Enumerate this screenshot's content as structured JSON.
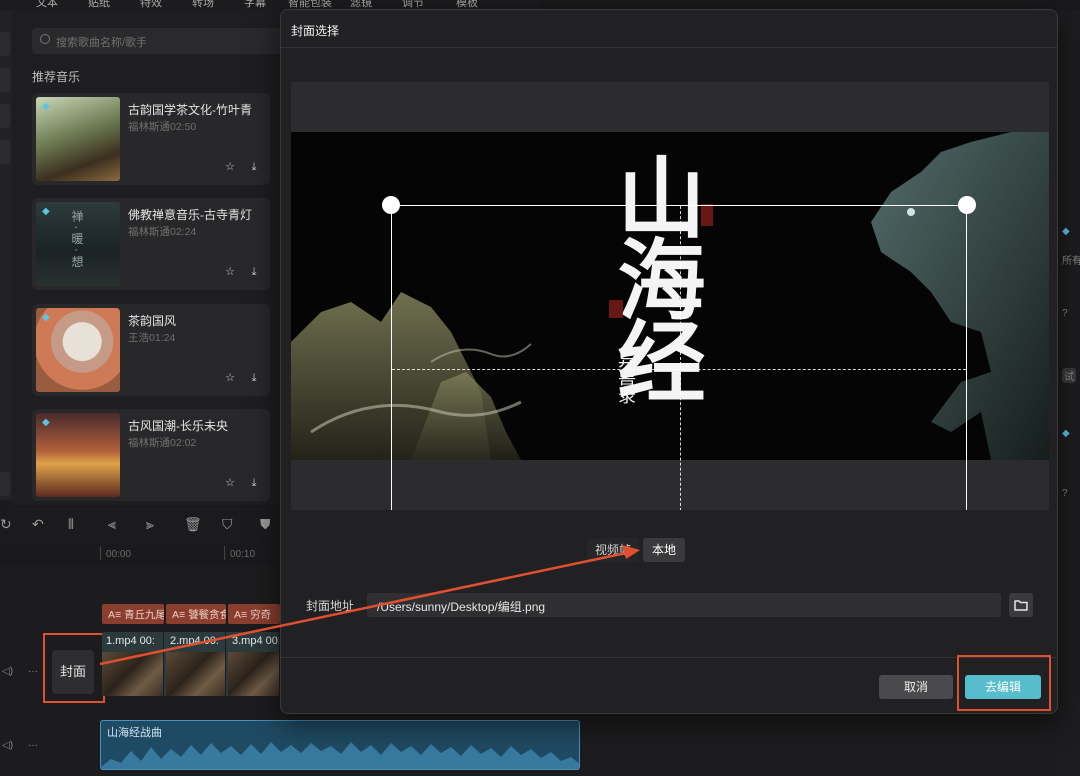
{
  "top_tabs": [
    "文本",
    "贴纸",
    "特效",
    "转场",
    "字幕",
    "智能包装",
    "滤镜",
    "调节",
    "模板"
  ],
  "music_panel": {
    "search_placeholder": "搜索歌曲名称/歌手",
    "section_title": "推荐音乐",
    "tracks": [
      {
        "title": "古韵国学茶文化-竹叶青",
        "artist": "福林斯通",
        "duration": "02:50"
      },
      {
        "title": "佛教禅意音乐-古寺青灯",
        "artist": "福林斯通",
        "duration": "02:24"
      },
      {
        "title": "茶韵国风",
        "artist": "王浩",
        "duration": "01:24"
      },
      {
        "title": "古风国潮-长乐未央",
        "artist": "福林斯通",
        "duration": "02:02"
      }
    ],
    "thumb_text": "禅 · 暖 · 想"
  },
  "timeline": {
    "ruler": [
      "00:00",
      "00:10"
    ],
    "text_clips": [
      "青丘九尾",
      "饕餮贪食",
      "穷奇"
    ],
    "video_clips": [
      "1.mp4",
      "2.mp4",
      "3.mp4"
    ],
    "video_clip_suffix": "00:",
    "cover_button": "封面",
    "audio_clip": "山海经战曲"
  },
  "right_strip": [
    "所有",
    "试"
  ],
  "dialog": {
    "title": "封面选择",
    "poster": {
      "title": "山海经",
      "subtitle": "异兽录"
    },
    "tabs": [
      {
        "label": "视频帧",
        "active": false
      },
      {
        "label": "本地",
        "active": true
      }
    ],
    "address_label": "封面地址",
    "address_value": "/Users/sunny/Desktop/编组.png",
    "cancel_label": "取消",
    "edit_label": "去编辑"
  },
  "colors": {
    "accent": "#57bccc",
    "annotation": "#e1502e",
    "audio": "#1f4a63",
    "text_clip": "#8a3e2e"
  }
}
